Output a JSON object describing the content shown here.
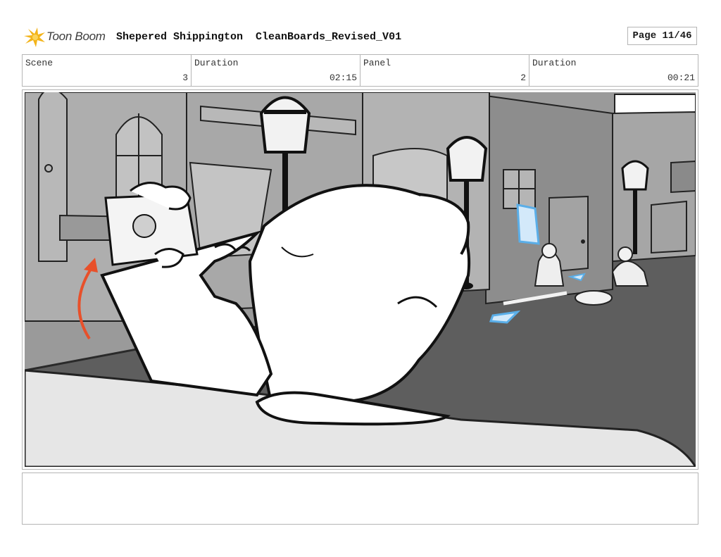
{
  "header": {
    "logo_text": "Toon Boom",
    "project_title": "Shepered Shippington  CleanBoards_Revised_V01",
    "page_label": "Page 11/46"
  },
  "info": {
    "scene_label": "Scene",
    "scene_value": "3",
    "scene_duration_label": "Duration",
    "scene_duration_value": "02:15",
    "panel_label": "Panel",
    "panel_value": "2",
    "panel_duration_label": "Duration",
    "panel_duration_value": "00:21"
  },
  "panel": {
    "accent_color": "#e8502a",
    "highlight_color": "#5aaee8"
  },
  "notes": {
    "text": ""
  }
}
